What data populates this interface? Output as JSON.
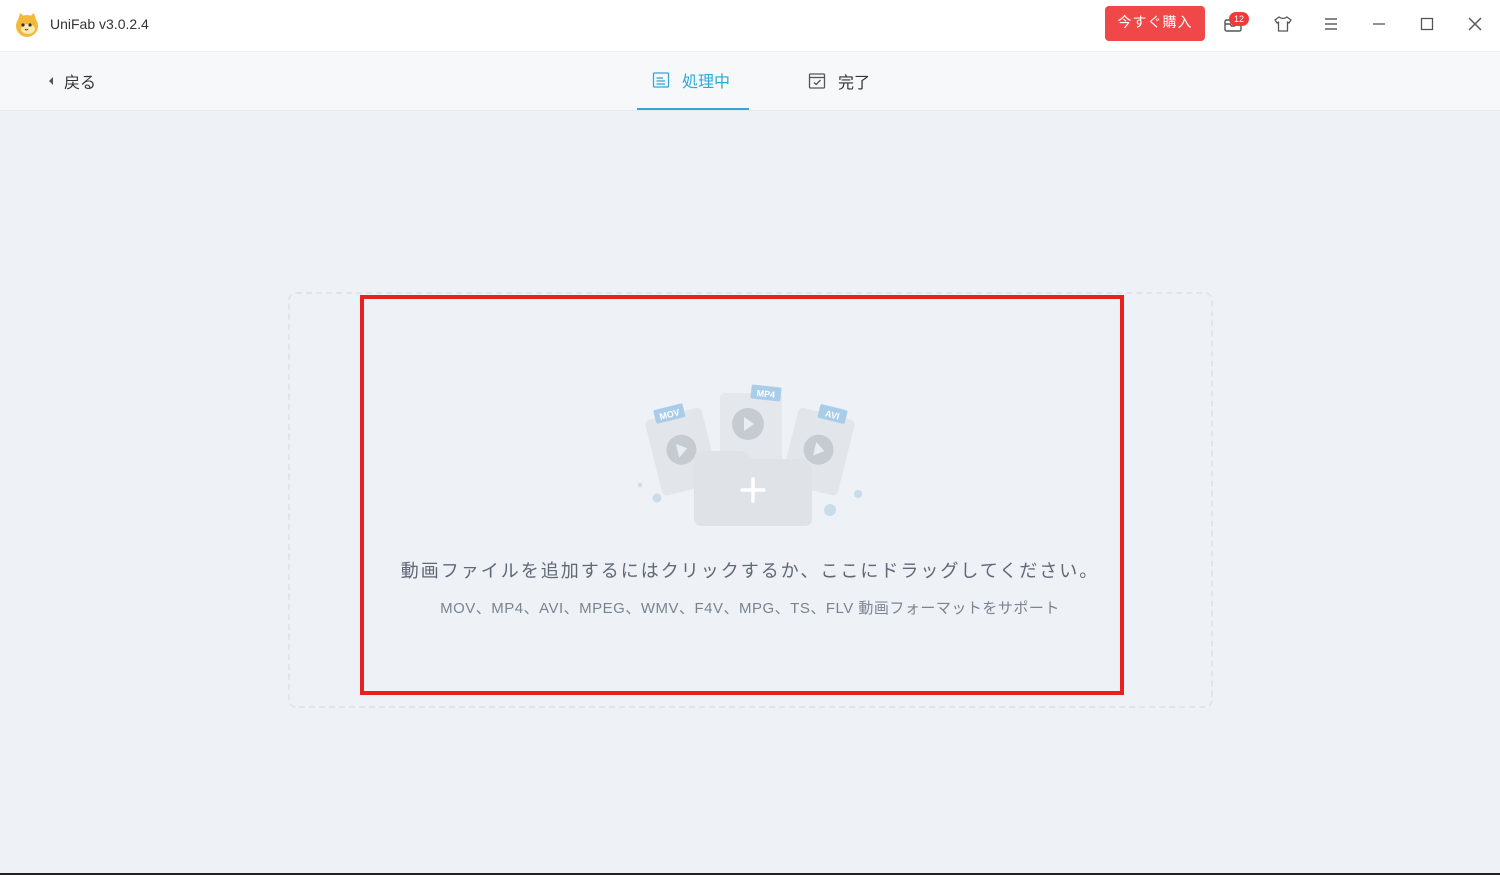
{
  "app": {
    "title": "UniFab v3.0.2.4",
    "brand_color": "#f04848",
    "accent_color": "#2fa8d8"
  },
  "titlebar": {
    "buy_label": "今すぐ購入",
    "notification_count": "12",
    "icons": [
      "mail-icon",
      "shirt-icon",
      "menu-icon",
      "minimize-icon",
      "maximize-icon",
      "close-icon"
    ]
  },
  "nav": {
    "back_label": "戻る",
    "tabs": [
      {
        "label": "処理中",
        "active": true
      },
      {
        "label": "完了",
        "active": false
      }
    ]
  },
  "dropzone": {
    "prompt": "動画ファイルを追加するにはクリックするか、ここにドラッグしてください。",
    "formats": "MOV、MP4、AVI、MPEG、WMV、F4V、MPG、TS、FLV 動画フォーマットをサポート",
    "file_tags": [
      "MOV",
      "MP4",
      "AVI"
    ]
  }
}
